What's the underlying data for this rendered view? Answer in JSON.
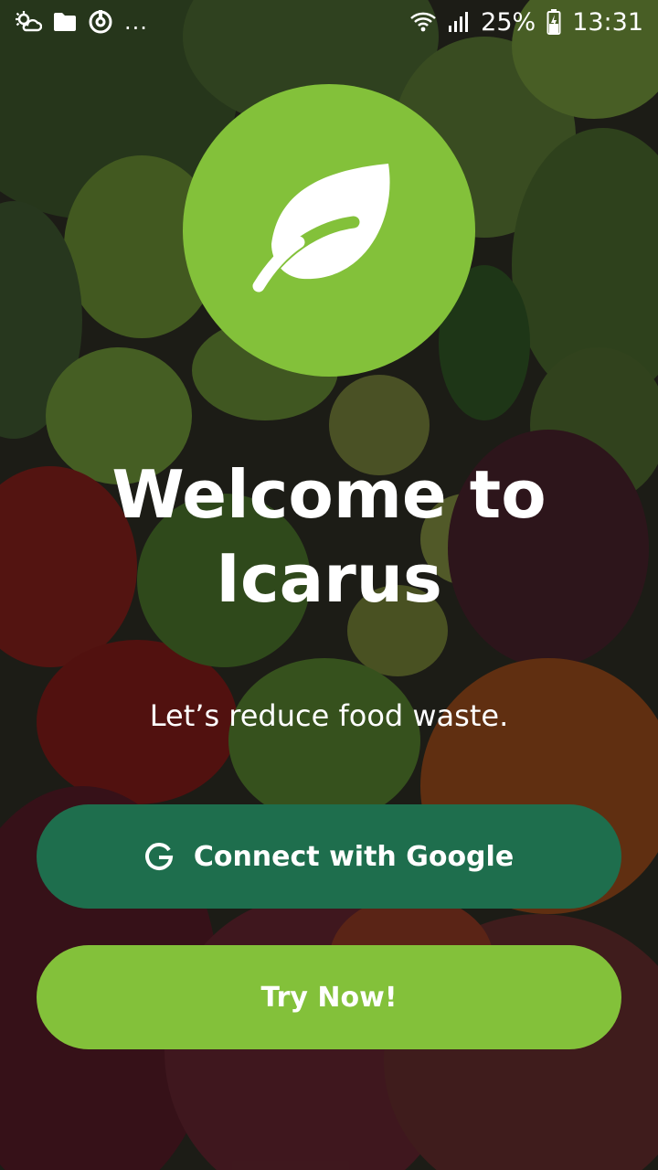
{
  "status_bar": {
    "battery_percent": "25%",
    "time": "13:31",
    "more_indicator": "..."
  },
  "app": {
    "logo_icon": "leaf-icon",
    "title_line1": "Welcome to",
    "title_line2": "Icarus",
    "subtitle": "Let’s reduce food waste."
  },
  "buttons": {
    "google_label": "Connect with Google",
    "google_icon": "google-g-icon",
    "try_label": "Try Now!"
  },
  "colors": {
    "brand_green": "#83c13a",
    "dark_green": "#1e6e4d",
    "text": "#ffffff"
  }
}
